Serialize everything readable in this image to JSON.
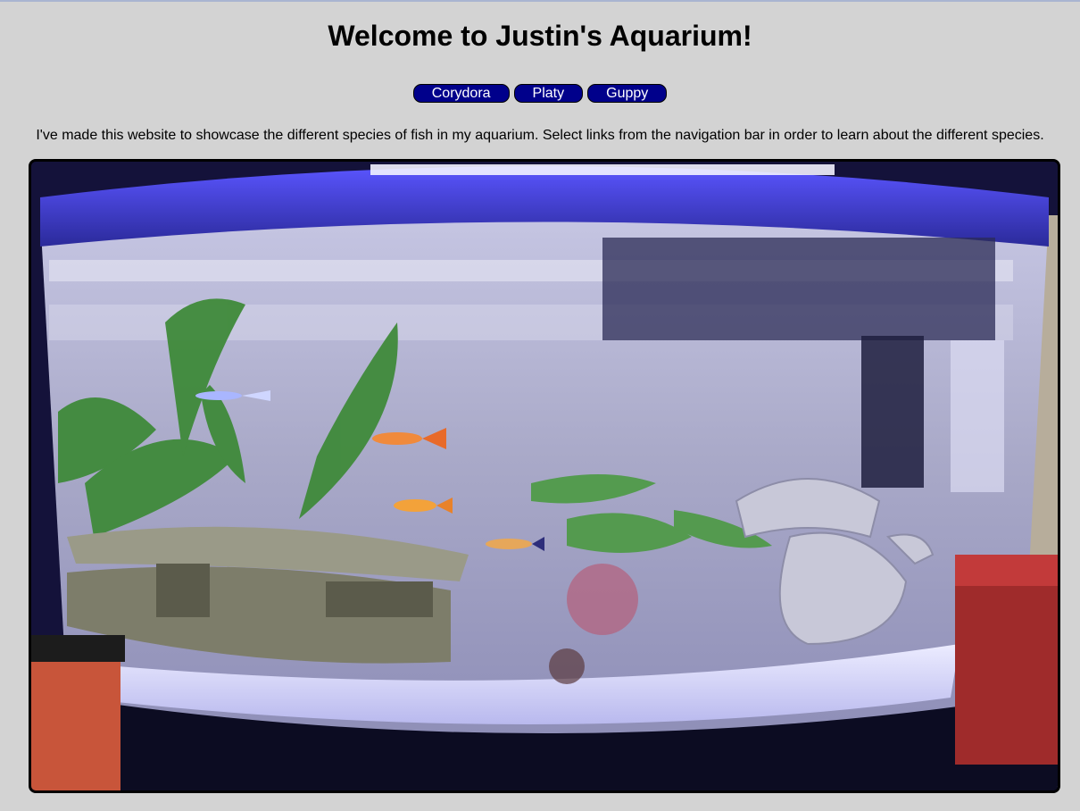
{
  "page": {
    "title": "Welcome to Justin's Aquarium!",
    "intro": "I've made this website to showcase the different species of fish in my aquarium. Select links from the navigation bar in order to learn about the different species."
  },
  "nav": {
    "items": [
      {
        "label": "Corydora"
      },
      {
        "label": "Platy"
      },
      {
        "label": "Guppy"
      }
    ]
  },
  "colors": {
    "background": "#d3d3d3",
    "nav_button": "#00008b",
    "nav_text": "#ffffff",
    "border": "#000000"
  },
  "image": {
    "subject": "aquarium-photo"
  }
}
